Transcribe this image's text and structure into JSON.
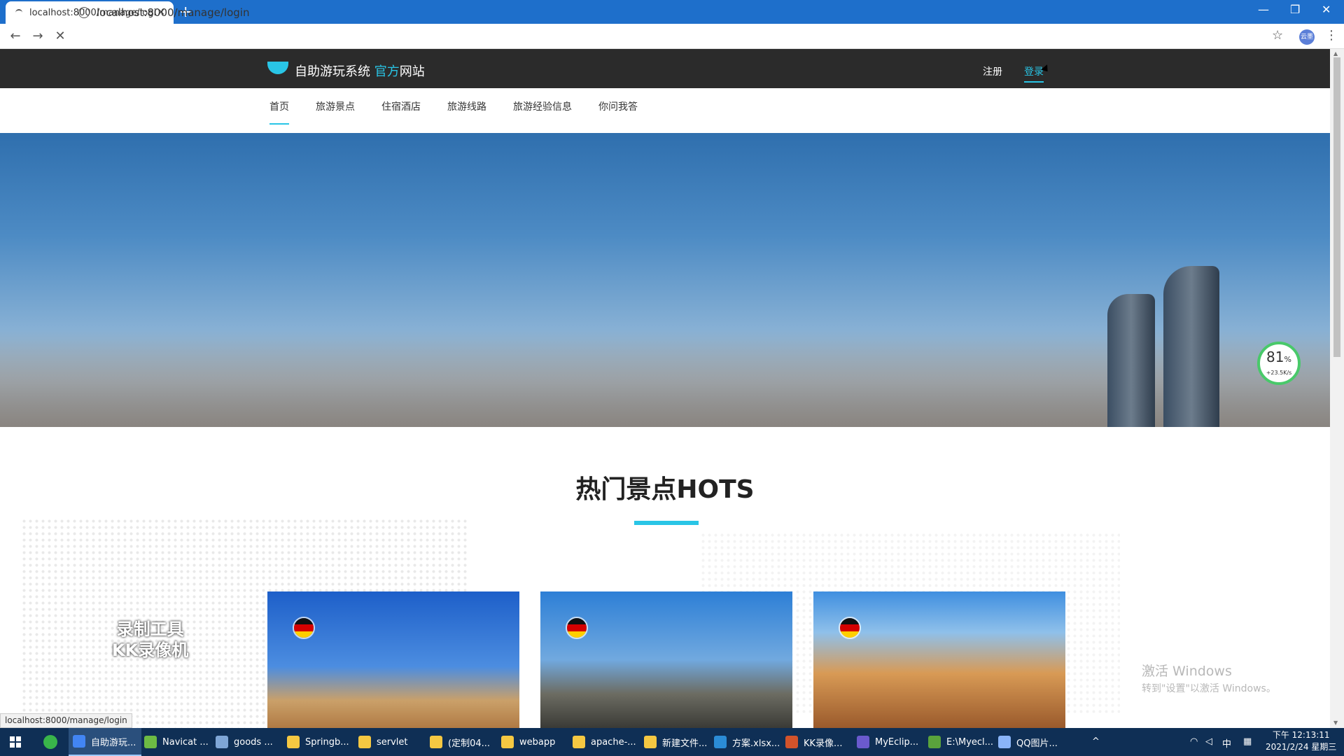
{
  "browser": {
    "tab_title": "localhost:8000/manage/login",
    "url": "localhost:8000/manage/login",
    "profile_label": "云墨",
    "status_url": "localhost:8000/manage/login"
  },
  "site": {
    "logo_main": "自助游玩系统 ",
    "logo_accent": "官方",
    "logo_tail": "网站",
    "top_links": [
      "注册",
      "登录"
    ],
    "nav": [
      "首页",
      "旅游景点",
      "住宿酒店",
      "旅游线路",
      "旅游经验信息",
      "你问我答"
    ],
    "hots_title": "热门景点HOTS"
  },
  "overlay": {
    "speed_percent": "81",
    "speed_unit": "%",
    "speed_rate": "+23.5K/s",
    "recorder_line1": "录制工具",
    "recorder_line2": "KK录像机",
    "windows_line1": "激活 Windows",
    "windows_line2": "转到\"设置\"以激活 Windows。"
  },
  "taskbar": {
    "items": [
      {
        "label": "自助游玩...",
        "color": "#4285f4"
      },
      {
        "label": "Navicat ...",
        "color": "#6dbb44"
      },
      {
        "label": "goods ...",
        "color": "#7fa6d6"
      },
      {
        "label": "Springb...",
        "color": "#f5c842"
      },
      {
        "label": "servlet",
        "color": "#f5c842"
      },
      {
        "label": "(定制04...",
        "color": "#f5c842"
      },
      {
        "label": "webapp",
        "color": "#f5c842"
      },
      {
        "label": "apache-...",
        "color": "#f5c842"
      },
      {
        "label": "新建文件...",
        "color": "#f5c842"
      },
      {
        "label": "方案.xlsx...",
        "color": "#2b8cd6"
      },
      {
        "label": "KK录像...",
        "color": "#d2532b"
      },
      {
        "label": "MyEclip...",
        "color": "#6a5acd"
      },
      {
        "label": "E:\\Myecl...",
        "color": "#5aa33c"
      },
      {
        "label": "QQ图片...",
        "color": "#8ab4f8"
      }
    ],
    "ime": "中",
    "time": "下午 12:13:11",
    "date": "2021/2/24 星期三"
  }
}
